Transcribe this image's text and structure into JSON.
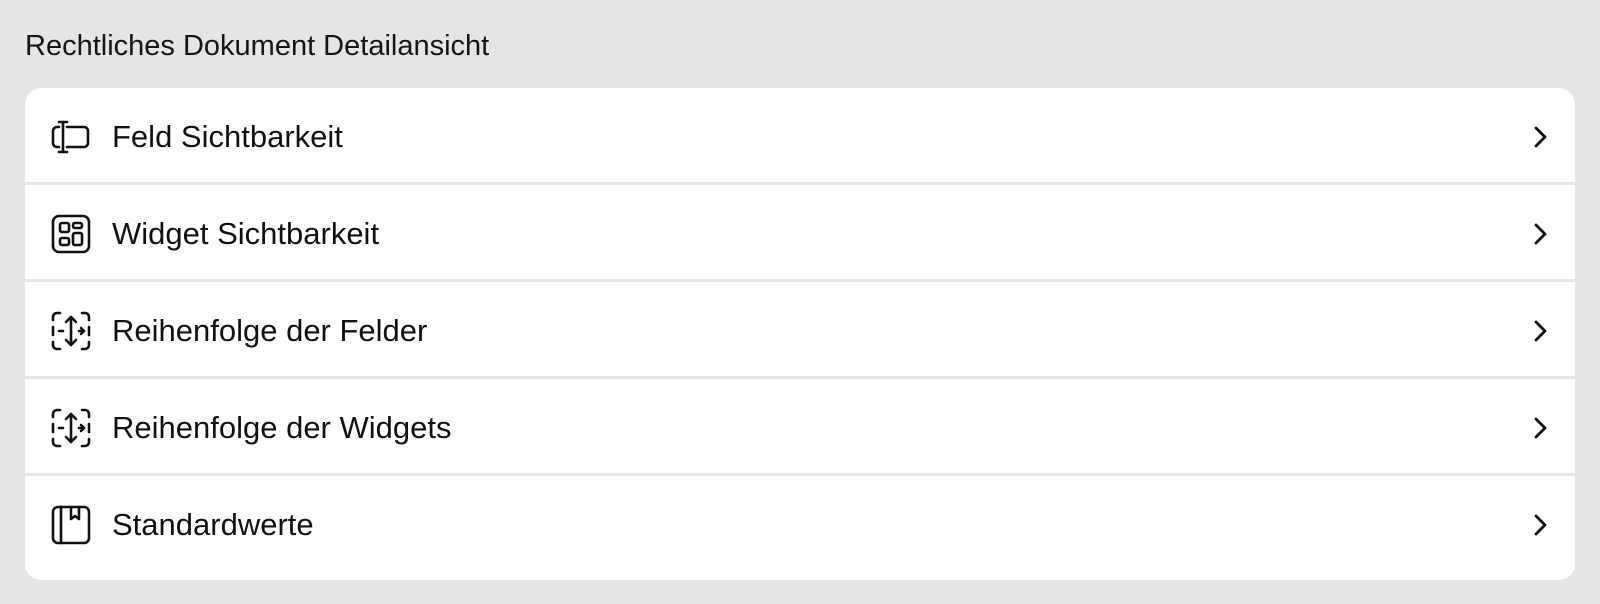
{
  "section": {
    "title": "Rechtliches Dokument Detailansicht"
  },
  "colors": {
    "background": "#e5e5e5",
    "card": "#ffffff",
    "text": "#111111",
    "divider": "#e5e5e5"
  },
  "menu": {
    "items": [
      {
        "label": "Feld Sichtbarkeit",
        "icon": "text-field-cursor-icon",
        "trailing_icon": "chevron-right-icon"
      },
      {
        "label": "Widget Sichtbarkeit",
        "icon": "widget-grid-icon",
        "trailing_icon": "chevron-right-icon"
      },
      {
        "label": "Reihenfolge der Felder",
        "icon": "reorder-arrows-icon",
        "trailing_icon": "chevron-right-icon"
      },
      {
        "label": "Reihenfolge der Widgets",
        "icon": "reorder-arrows-icon",
        "trailing_icon": "chevron-right-icon"
      },
      {
        "label": "Standardwerte",
        "icon": "bookmark-book-icon",
        "trailing_icon": "chevron-right-icon"
      }
    ]
  }
}
